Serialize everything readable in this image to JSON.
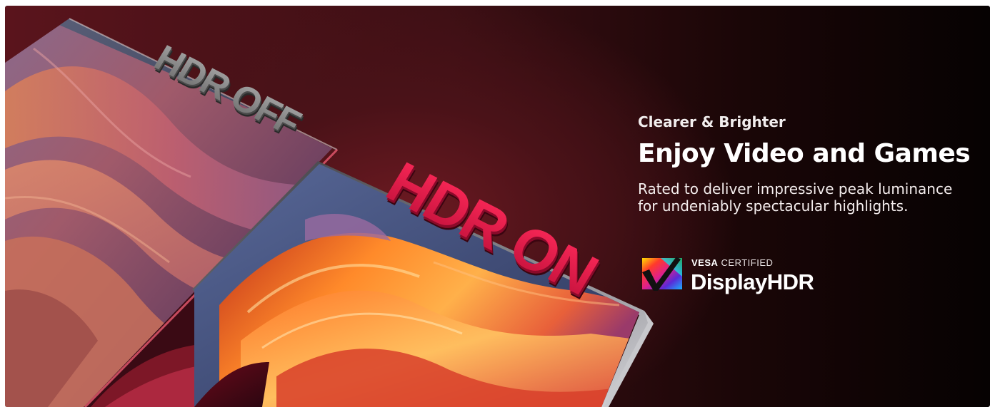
{
  "hero": {
    "label_off": "HDR OFF",
    "label_on": "HDR ON"
  },
  "copy": {
    "eyebrow": "Clearer & Brighter",
    "headline": "Enjoy Video and Games",
    "body": "Rated to deliver impressive peak luminance for undeniably spectacular highlights."
  },
  "badge": {
    "top_bold": "VESA",
    "top_regular": "CERTIFIED",
    "main": "DisplayHDR"
  },
  "colors": {
    "hdr_on_text": "#e0184a",
    "hdr_off_text": "#8a8a8a",
    "background": "#3c0f14"
  }
}
